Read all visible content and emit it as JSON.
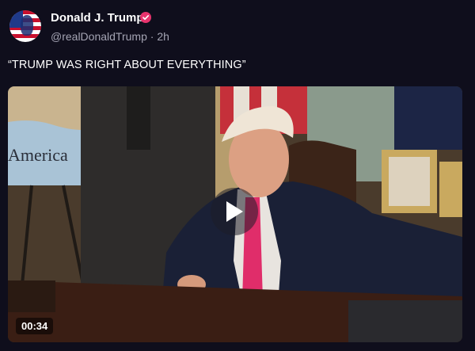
{
  "post": {
    "author": {
      "display_name": "Donald J. Trump",
      "verified_icon": "verified-badge-icon",
      "handle": "@realDonaldTrump",
      "separator": "·",
      "time": "2h",
      "avatar_icon": "profile-avatar"
    },
    "text": "“TRUMP WAS RIGHT ABOUT EVERYTHING”",
    "video": {
      "map_label": "America",
      "duration": "00:34",
      "play_icon": "play-icon"
    }
  },
  "colors": {
    "background": "#0f0e1c",
    "name": "#ffffff",
    "meta": "#a4a4b3",
    "verified": "#e8336d"
  }
}
